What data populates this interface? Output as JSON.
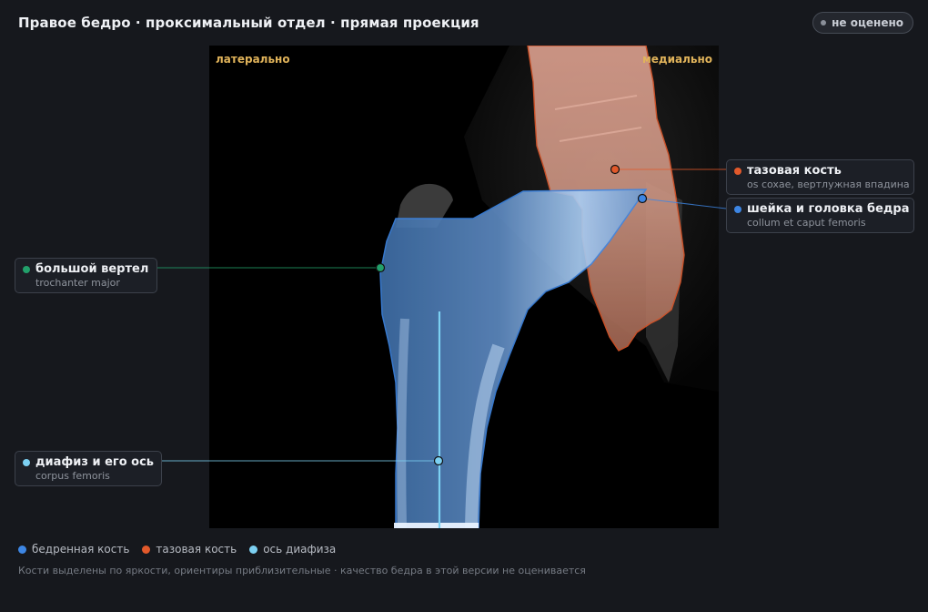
{
  "header": {
    "title": "Правое бедро · проксимальный отдел · прямая проекция",
    "status_badge": "не оценено"
  },
  "viewer": {
    "orientation_left": "латерально",
    "orientation_right": "медиально"
  },
  "annotations": [
    {
      "id": "pelvis",
      "title": "тазовая кость",
      "subtitle": "os coxae, вертлужная впадина",
      "color": "#e2592b"
    },
    {
      "id": "neck",
      "title": "шейка и головка бедра",
      "subtitle": "collum et caput femoris",
      "color": "#3d86e4"
    },
    {
      "id": "trochanter",
      "title": "большой вертел",
      "subtitle": "trochanter major",
      "color": "#22a06b"
    },
    {
      "id": "shaft",
      "title": "диафиз и его ось",
      "subtitle": "corpus femoris",
      "color": "#7cd0f2"
    }
  ],
  "legend": [
    {
      "label": "бедренная кость",
      "color": "#3d86e4"
    },
    {
      "label": "тазовая кость",
      "color": "#e2592b"
    },
    {
      "label": "ось диафиза",
      "color": "#7cd0f2"
    }
  ],
  "footnote": "Кости выделены по яркости, ориентиры приблизительные · качество бедра в этой версии не оценивается"
}
